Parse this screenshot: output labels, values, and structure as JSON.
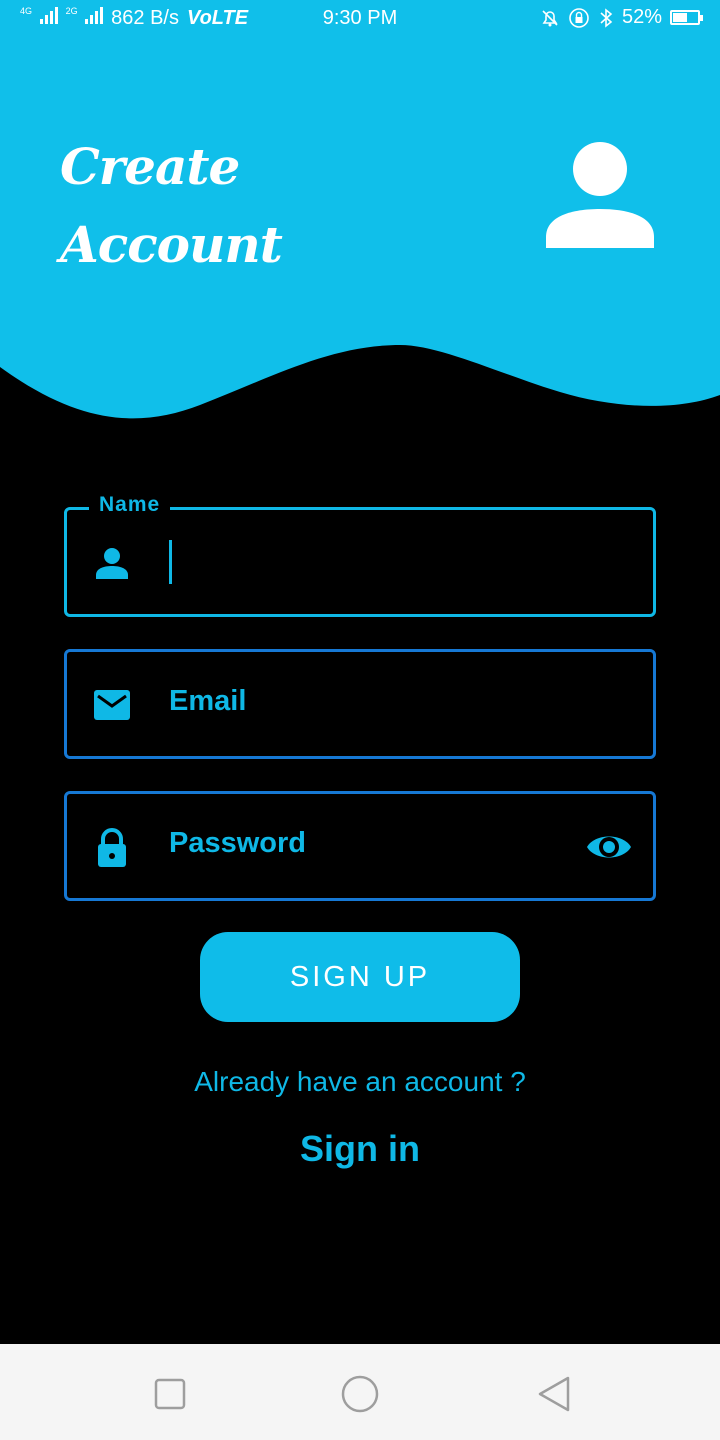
{
  "status_bar": {
    "network_tag_1": "4G",
    "network_tag_2": "2G",
    "speed": "862 B/s",
    "volte": "VoLTE",
    "time": "9:30 PM",
    "battery": "52%",
    "battery_level": 0.52
  },
  "header": {
    "title_line1": "Create",
    "title_line2": "Account",
    "avatar_icon": "person-icon"
  },
  "form": {
    "name": {
      "label": "Name",
      "value": "",
      "icon": "person-icon"
    },
    "email": {
      "placeholder": "Email",
      "icon": "mail-icon"
    },
    "password": {
      "placeholder": "Password",
      "icon": "lock-icon",
      "toggle_icon": "eye-icon"
    }
  },
  "actions": {
    "signup_label": "SIGN UP",
    "already_text": "Already have an account ?",
    "signin_label": "Sign in"
  },
  "nav": {
    "recents_icon": "square-icon",
    "home_icon": "circle-icon",
    "back_icon": "triangle-back-icon"
  },
  "colors": {
    "accent": "#0fb8e6",
    "header_bg": "#10bfea",
    "background": "#000000",
    "field_border_dim": "#1678d4"
  }
}
